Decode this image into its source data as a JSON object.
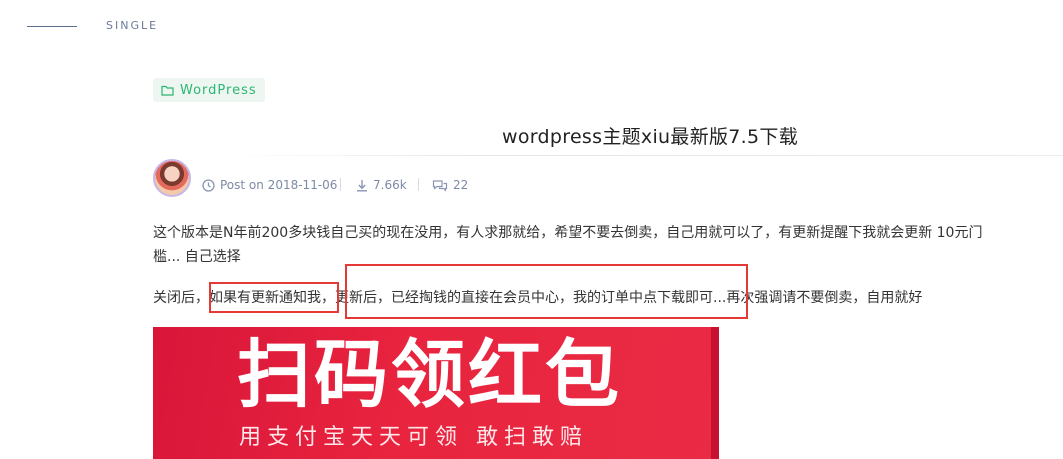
{
  "section": {
    "label": "SINGLE"
  },
  "category": {
    "icon": "folder-icon",
    "label": "WordPress"
  },
  "post": {
    "title": "wordpress主题xiu最新版7.5下载",
    "meta": {
      "date": "Post on 2018-11-06",
      "views": "7.66k",
      "comments": "22"
    },
    "paragraphs": [
      "这个版本是N年前200多块钱自己买的现在没用，有人求那就给，希望不要去倒卖，自己用就可以了，有更新提醒下我就会更新 10元门槛... 自己选择",
      "关闭后，如果有更新通知我，更新后，已经掏钱的直接在会员中心，我的订单中点下载即可...再次强调请不要倒卖，自用就好"
    ]
  },
  "banner": {
    "headline": "扫码领红包",
    "subline": "用支付宝天天可领 敢扫敢赔"
  },
  "colors": {
    "accent_green": "#2bb673",
    "meta_gray": "#7d8aa6",
    "highlight_red": "#e53935",
    "banner_red": "#e8243e"
  }
}
